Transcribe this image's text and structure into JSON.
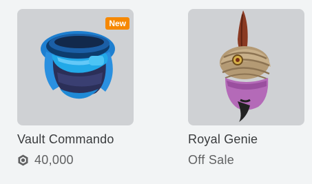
{
  "items": [
    {
      "name": "Vault Commando",
      "badge": "New",
      "price": "40,000",
      "currency_icon": "robux-icon"
    },
    {
      "name": "Royal Genie",
      "price": "Off Sale"
    }
  ],
  "colors": {
    "page_background": "#f2f4f5",
    "thumbnail_background": "#cfd1d4",
    "badge_background": "#f68802",
    "name_text": "#393b3d",
    "price_text": "#606162"
  }
}
